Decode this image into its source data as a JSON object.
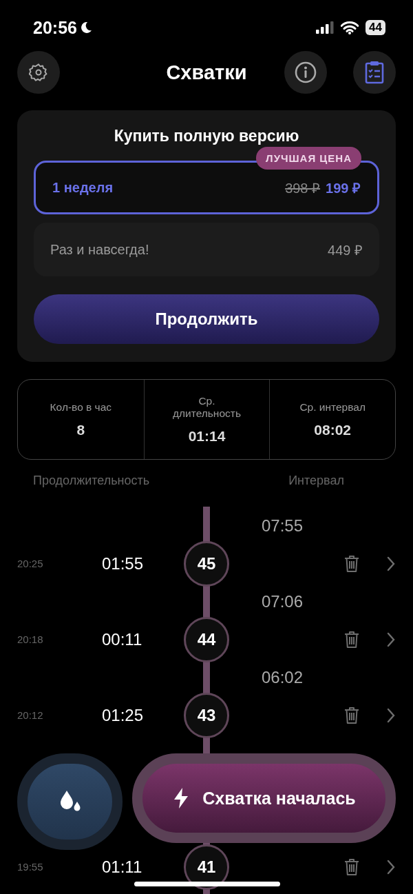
{
  "status_bar": {
    "time": "20:56",
    "battery": "44"
  },
  "header": {
    "title": "Схватки"
  },
  "purchase": {
    "title": "Купить полную версию",
    "badge": "ЛУЧШАЯ ЦЕНА",
    "plans": [
      {
        "label": "1 неделя",
        "old_price": "398 ₽",
        "price": "199 ₽",
        "selected": true
      },
      {
        "label": "Раз и навсегда!",
        "price": "449 ₽",
        "selected": false
      }
    ],
    "button": "Продолжить"
  },
  "stats": [
    {
      "label": "Кол-во в час",
      "value": "8"
    },
    {
      "label": "Ср. длительность",
      "value": "01:14"
    },
    {
      "label": "Ср. интервал",
      "value": "08:02"
    }
  ],
  "columns": [
    "Продолжительность",
    "Интервал"
  ],
  "rows": [
    {
      "interval": "07:55",
      "start": "20:25",
      "duration": "01:55",
      "number": "45"
    },
    {
      "interval": "07:06",
      "start": "20:18",
      "duration": "00:11",
      "number": "44"
    },
    {
      "interval": "06:02",
      "start": "20:12",
      "duration": "01:25",
      "number": "43"
    },
    {
      "start": "19:55",
      "duration": "01:11",
      "number": "41"
    }
  ],
  "actions": {
    "main": "Схватка началась"
  }
}
